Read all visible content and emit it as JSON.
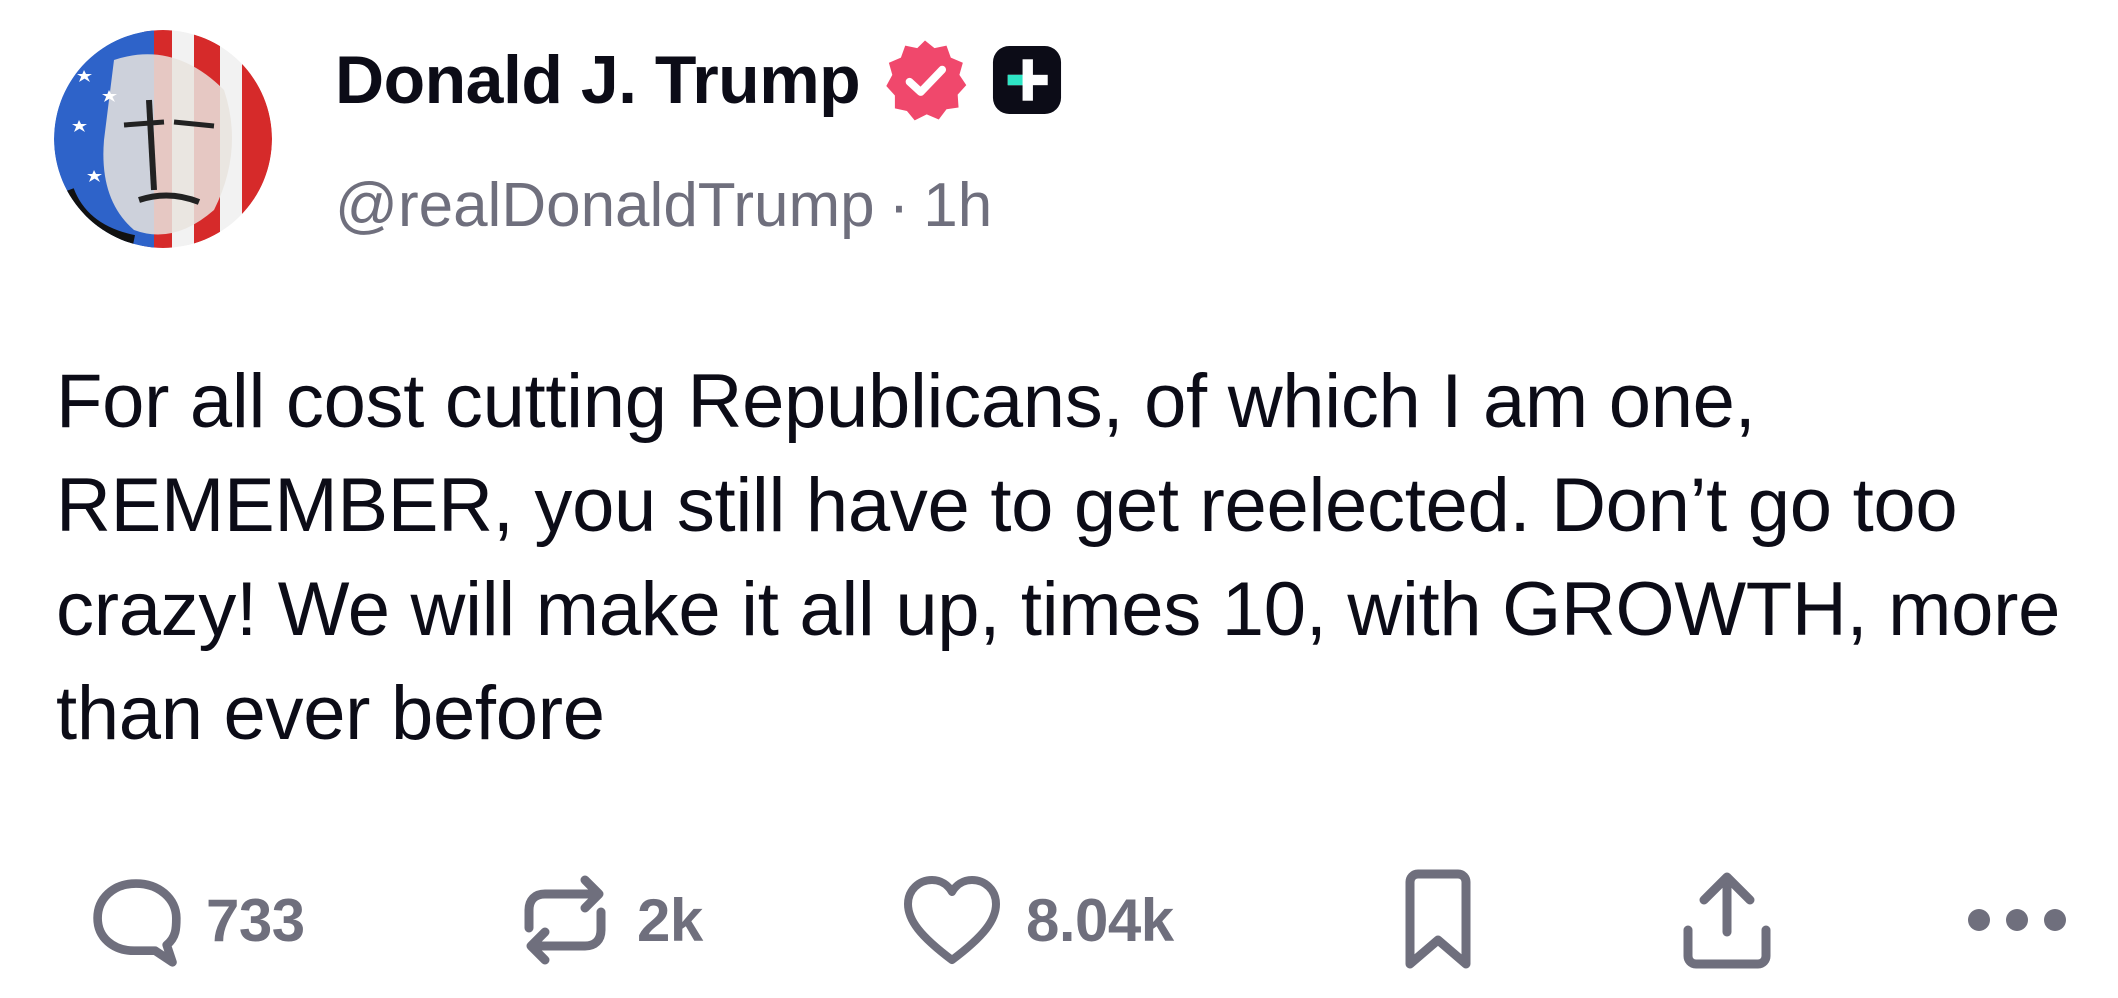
{
  "author": {
    "display_name": "Donald J. Trump",
    "handle": "@realDonaldTrump",
    "separator": "·",
    "time_ago": "1h",
    "verified_badge_icon": "verified-check-icon",
    "verified_badge_color": "#f0486c",
    "plus_badge_icon": "plus-badge-icon"
  },
  "post": {
    "text": "For all cost cutting Republicans, of which I am one, REMEMBER, you still have to get reelected. Don’t go too crazy! We will make it all up, times 10, with GROWTH, more than ever before"
  },
  "actions": {
    "reply": {
      "icon": "reply-icon",
      "count": "733"
    },
    "repost": {
      "icon": "repost-icon",
      "count": "2k"
    },
    "like": {
      "icon": "heart-icon",
      "count": "8.04k"
    },
    "bookmark": {
      "icon": "bookmark-icon"
    },
    "share": {
      "icon": "share-icon"
    },
    "more": {
      "icon": "more-dots-icon"
    }
  },
  "colors": {
    "text_primary": "#0c0c17",
    "text_secondary": "#6f6f7d",
    "badge_pink": "#f0486c",
    "plus_badge_bg": "#0c0c17",
    "plus_badge_accent": "#2ee6c5"
  }
}
